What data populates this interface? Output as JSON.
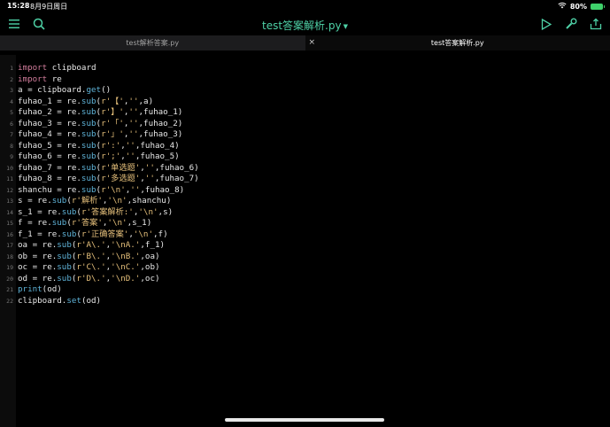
{
  "status": {
    "time": "15:28",
    "date": "8月9日周日",
    "battery": "80%"
  },
  "toolbar": {
    "title": "test答案解析.py",
    "icons": [
      "menu-icon",
      "search-icon",
      "play-icon",
      "wrench-icon",
      "share-icon"
    ]
  },
  "tabs": [
    {
      "label": "test解析答案.py",
      "active": false
    },
    {
      "label": "test答案解析.py",
      "active": true
    }
  ],
  "code": [
    "import clipboard",
    "import re",
    "a = clipboard.get()",
    "fuhao_1 = re.sub(r'【','',a)",
    "fuhao_2 = re.sub(r'】','',fuhao_1)",
    "fuhao_3 = re.sub(r'「','',fuhao_2)",
    "fuhao_4 = re.sub(r'」','',fuhao_3)",
    "fuhao_5 = re.sub(r':','',fuhao_4)",
    "fuhao_6 = re.sub(r';','',fuhao_5)",
    "fuhao_7 = re.sub(r'单选题','',fuhao_6)",
    "fuhao_8 = re.sub(r'多选题','',fuhao_7)",
    "shanchu = re.sub(r'\\n','',fuhao_8)",
    "s = re.sub(r'解析','\\n',shanchu)",
    "s_1 = re.sub(r'答案解析:','\\n',s)",
    "f = re.sub(r'答案','\\n',s_1)",
    "f_1 = re.sub(r'正确答案','\\n',f)",
    "oa = re.sub(r'A\\.','\\nA.',f_1)",
    "ob = re.sub(r'B\\.','\\nB.',oa)",
    "oc = re.sub(r'C\\.','\\nC.',ob)",
    "od = re.sub(r'D\\.','\\nD.',oc)",
    "print(od)",
    "clipboard.set(od)"
  ],
  "colors": {
    "accent": "#4ed1a6",
    "keyword": "#d27d9c",
    "string": "#e6c07b",
    "func": "#5fb3d8"
  }
}
